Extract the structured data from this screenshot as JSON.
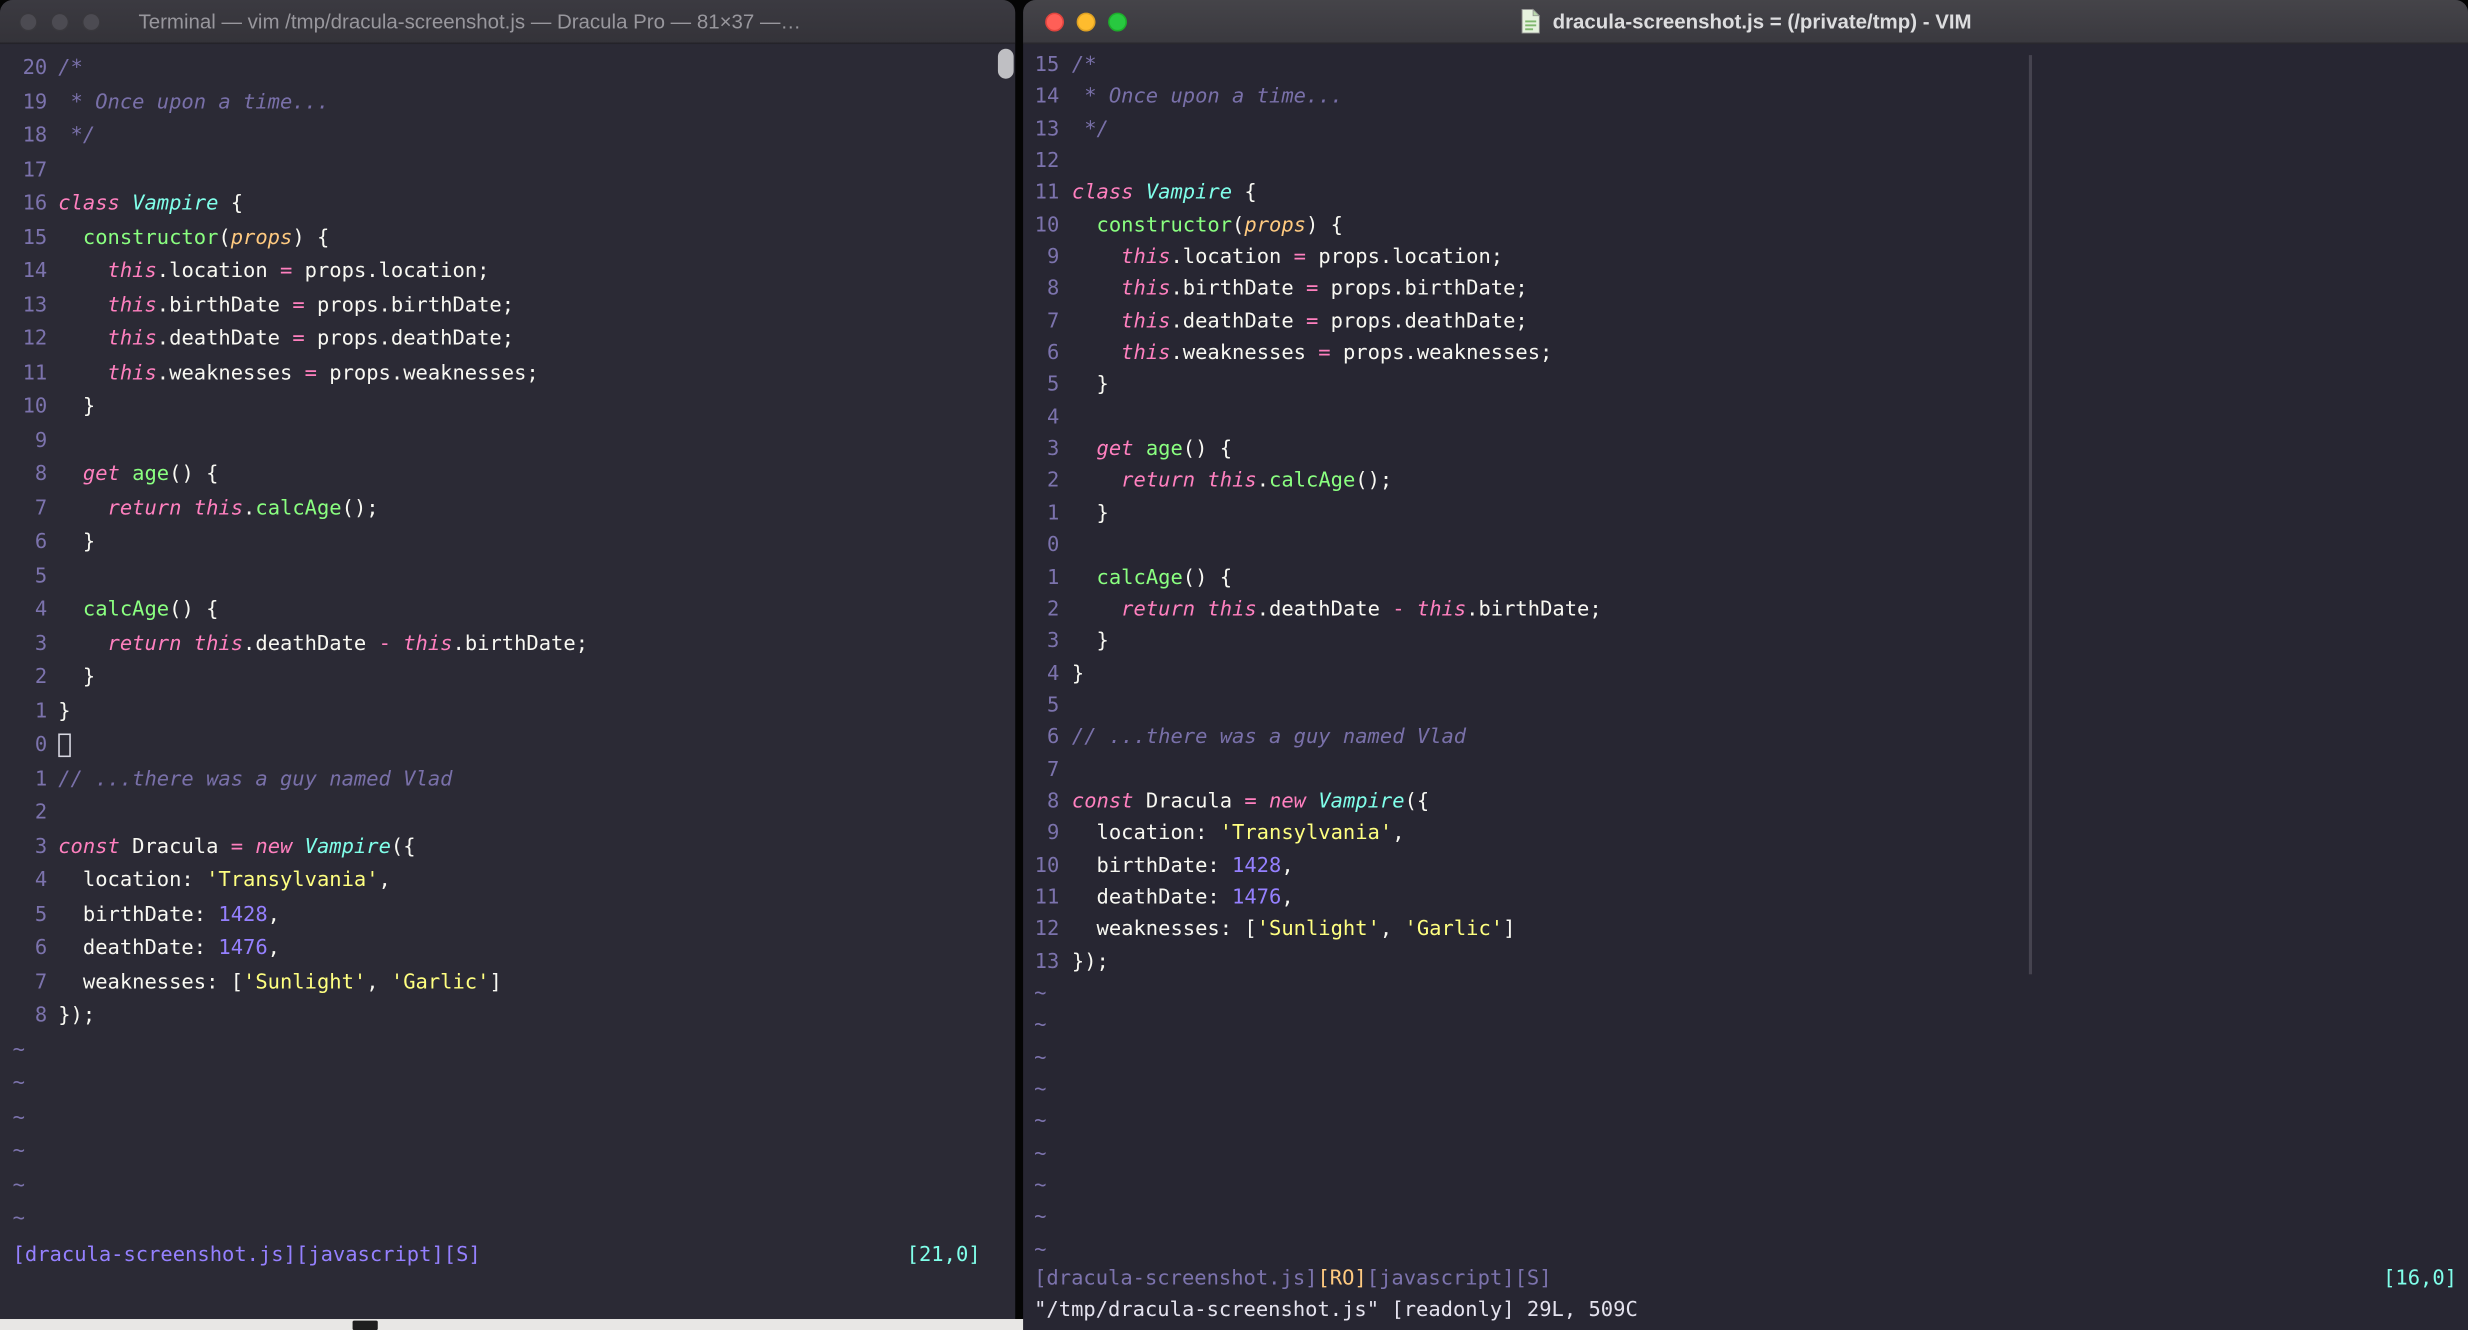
{
  "palette": {
    "background_left": "#2B2A35",
    "background_right": "#272632",
    "foreground": "#F8F8F2",
    "comment": "#7970A9",
    "pink": "#FF80BF",
    "green": "#8AFF80",
    "cyan": "#80FFEA",
    "purple": "#9580FF",
    "yellow": "#FFFF80",
    "orange": "#FFCA80"
  },
  "code": {
    "lines": [
      [
        [
          "c",
          "/*"
        ]
      ],
      [
        [
          "c",
          " * Once upon a time..."
        ]
      ],
      [
        [
          "c",
          " */"
        ]
      ],
      [],
      [
        [
          "k",
          "class"
        ],
        [
          "f",
          " "
        ],
        [
          "cl",
          "Vampire"
        ],
        [
          "f",
          " {"
        ]
      ],
      [
        [
          "f",
          "  "
        ],
        [
          "fn",
          "constructor"
        ],
        [
          "f",
          "("
        ],
        [
          "pr",
          "props"
        ],
        [
          "f",
          ") {"
        ]
      ],
      [
        [
          "f",
          "    "
        ],
        [
          "k",
          "this"
        ],
        [
          "f",
          ".location "
        ],
        [
          "op",
          "="
        ],
        [
          "f",
          " props.location;"
        ]
      ],
      [
        [
          "f",
          "    "
        ],
        [
          "k",
          "this"
        ],
        [
          "f",
          ".birthDate "
        ],
        [
          "op",
          "="
        ],
        [
          "f",
          " props.birthDate;"
        ]
      ],
      [
        [
          "f",
          "    "
        ],
        [
          "k",
          "this"
        ],
        [
          "f",
          ".deathDate "
        ],
        [
          "op",
          "="
        ],
        [
          "f",
          " props.deathDate;"
        ]
      ],
      [
        [
          "f",
          "    "
        ],
        [
          "k",
          "this"
        ],
        [
          "f",
          ".weaknesses "
        ],
        [
          "op",
          "="
        ],
        [
          "f",
          " props.weaknesses;"
        ]
      ],
      [
        [
          "f",
          "  }"
        ]
      ],
      [],
      [
        [
          "f",
          "  "
        ],
        [
          "k",
          "get"
        ],
        [
          "f",
          " "
        ],
        [
          "fn",
          "age"
        ],
        [
          "f",
          "() {"
        ]
      ],
      [
        [
          "f",
          "    "
        ],
        [
          "k",
          "return"
        ],
        [
          "f",
          " "
        ],
        [
          "k",
          "this"
        ],
        [
          "f",
          "."
        ],
        [
          "fn",
          "calcAge"
        ],
        [
          "f",
          "();"
        ]
      ],
      [
        [
          "f",
          "  }"
        ]
      ],
      [],
      [
        [
          "f",
          "  "
        ],
        [
          "fn",
          "calcAge"
        ],
        [
          "f",
          "() {"
        ]
      ],
      [
        [
          "f",
          "    "
        ],
        [
          "k",
          "return"
        ],
        [
          "f",
          " "
        ],
        [
          "k",
          "this"
        ],
        [
          "f",
          ".deathDate "
        ],
        [
          "op",
          "-"
        ],
        [
          "f",
          " "
        ],
        [
          "k",
          "this"
        ],
        [
          "f",
          ".birthDate;"
        ]
      ],
      [
        [
          "f",
          "  }"
        ]
      ],
      [
        [
          "f",
          "}"
        ]
      ],
      [],
      [
        [
          "c",
          "// ...there was a guy named Vlad"
        ]
      ],
      [],
      [
        [
          "k",
          "const"
        ],
        [
          "f",
          " Dracula "
        ],
        [
          "op",
          "="
        ],
        [
          "f",
          " "
        ],
        [
          "k",
          "new"
        ],
        [
          "f",
          " "
        ],
        [
          "cl",
          "Vampire"
        ],
        [
          "f",
          "({"
        ]
      ],
      [
        [
          "f",
          "  location: "
        ],
        [
          "str",
          "'Transylvania'"
        ],
        [
          "f",
          ","
        ]
      ],
      [
        [
          "f",
          "  birthDate: "
        ],
        [
          "num",
          "1428"
        ],
        [
          "f",
          ","
        ]
      ],
      [
        [
          "f",
          "  deathDate: "
        ],
        [
          "num",
          "1476"
        ],
        [
          "f",
          ","
        ]
      ],
      [
        [
          "f",
          "  weaknesses: ["
        ],
        [
          "str",
          "'Sunlight'"
        ],
        [
          "f",
          ", "
        ],
        [
          "str",
          "'Garlic'"
        ],
        [
          "f",
          "]"
        ]
      ],
      [
        [
          "f",
          "});"
        ]
      ]
    ]
  },
  "left_window": {
    "title": "Terminal — vim /tmp/dracula-screenshot.js — Dracula Pro — 81×37 —…",
    "numbers": [
      "20",
      "19",
      "18",
      "17",
      "16",
      "15",
      "14",
      "13",
      "12",
      "11",
      "10",
      "9",
      "8",
      "7",
      "6",
      "5",
      "4",
      "3",
      "2",
      "1",
      "0",
      "1",
      "2",
      "3",
      "4",
      "5",
      "6",
      "7",
      "8"
    ],
    "cursor_row": 20,
    "cursor_style": "hollow",
    "tilde_count": 6,
    "status_left": "[dracula-screenshot.js][javascript][S]",
    "status_right": "[21,0]"
  },
  "right_window": {
    "title": "dracula-screenshot.js = (/private/tmp) - VIM",
    "numbers": [
      "15",
      "14",
      "13",
      "12",
      "11",
      "10",
      "9",
      "8",
      "7",
      "6",
      "5",
      "4",
      "3",
      "2",
      "1",
      "0",
      "1",
      "2",
      "3",
      "4",
      "5",
      "6",
      "7",
      "8",
      "9",
      "10",
      "11",
      "12",
      "13"
    ],
    "cursor_row": 15,
    "cursor_style": "none",
    "tilde_count": 9,
    "status_file": "[dracula-screenshot.js]",
    "status_ro": "[RO]",
    "status_rest": "[javascript][S]",
    "status_right": "[16,0]",
    "command_line": "\"/tmp/dracula-screenshot.js\" [readonly] 29L, 509C"
  }
}
